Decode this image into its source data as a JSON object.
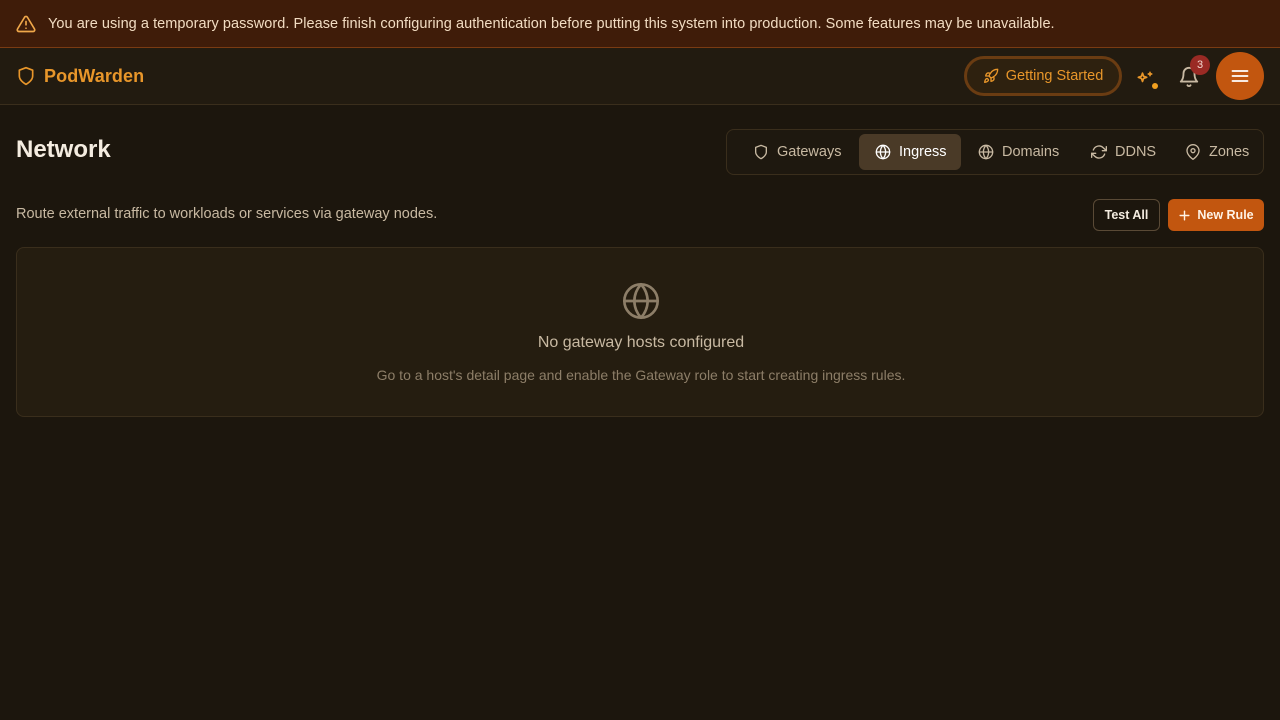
{
  "banner": {
    "text": "You are using a temporary password. Please finish configuring authentication before putting this system into production. Some features may be unavailable.",
    "icon": "warning-triangle-icon"
  },
  "header": {
    "brand": "PodWarden",
    "getting_started_label": "Getting Started",
    "notification_count": "3"
  },
  "page": {
    "title": "Network",
    "subtitle": "Route external traffic to workloads or services via gateway nodes."
  },
  "tabs": [
    {
      "label": "Gateways",
      "icon": "shield-icon",
      "active": false
    },
    {
      "label": "Ingress",
      "icon": "globe-icon",
      "active": true
    },
    {
      "label": "Domains",
      "icon": "globe-icon",
      "active": false
    },
    {
      "label": "DDNS",
      "icon": "refresh-icon",
      "active": false
    },
    {
      "label": "Zones",
      "icon": "map-pin-icon",
      "active": false
    }
  ],
  "actions": {
    "test_all_label": "Test All",
    "new_rule_label": "New Rule"
  },
  "empty_state": {
    "title": "No gateway hosts configured",
    "description": "Go to a host's detail page and enable the Gateway role to start creating ingress rules."
  },
  "colors": {
    "accent": "#c2560f",
    "brand": "#e8962a",
    "background": "#1c160d",
    "banner": "#3f1c09"
  }
}
